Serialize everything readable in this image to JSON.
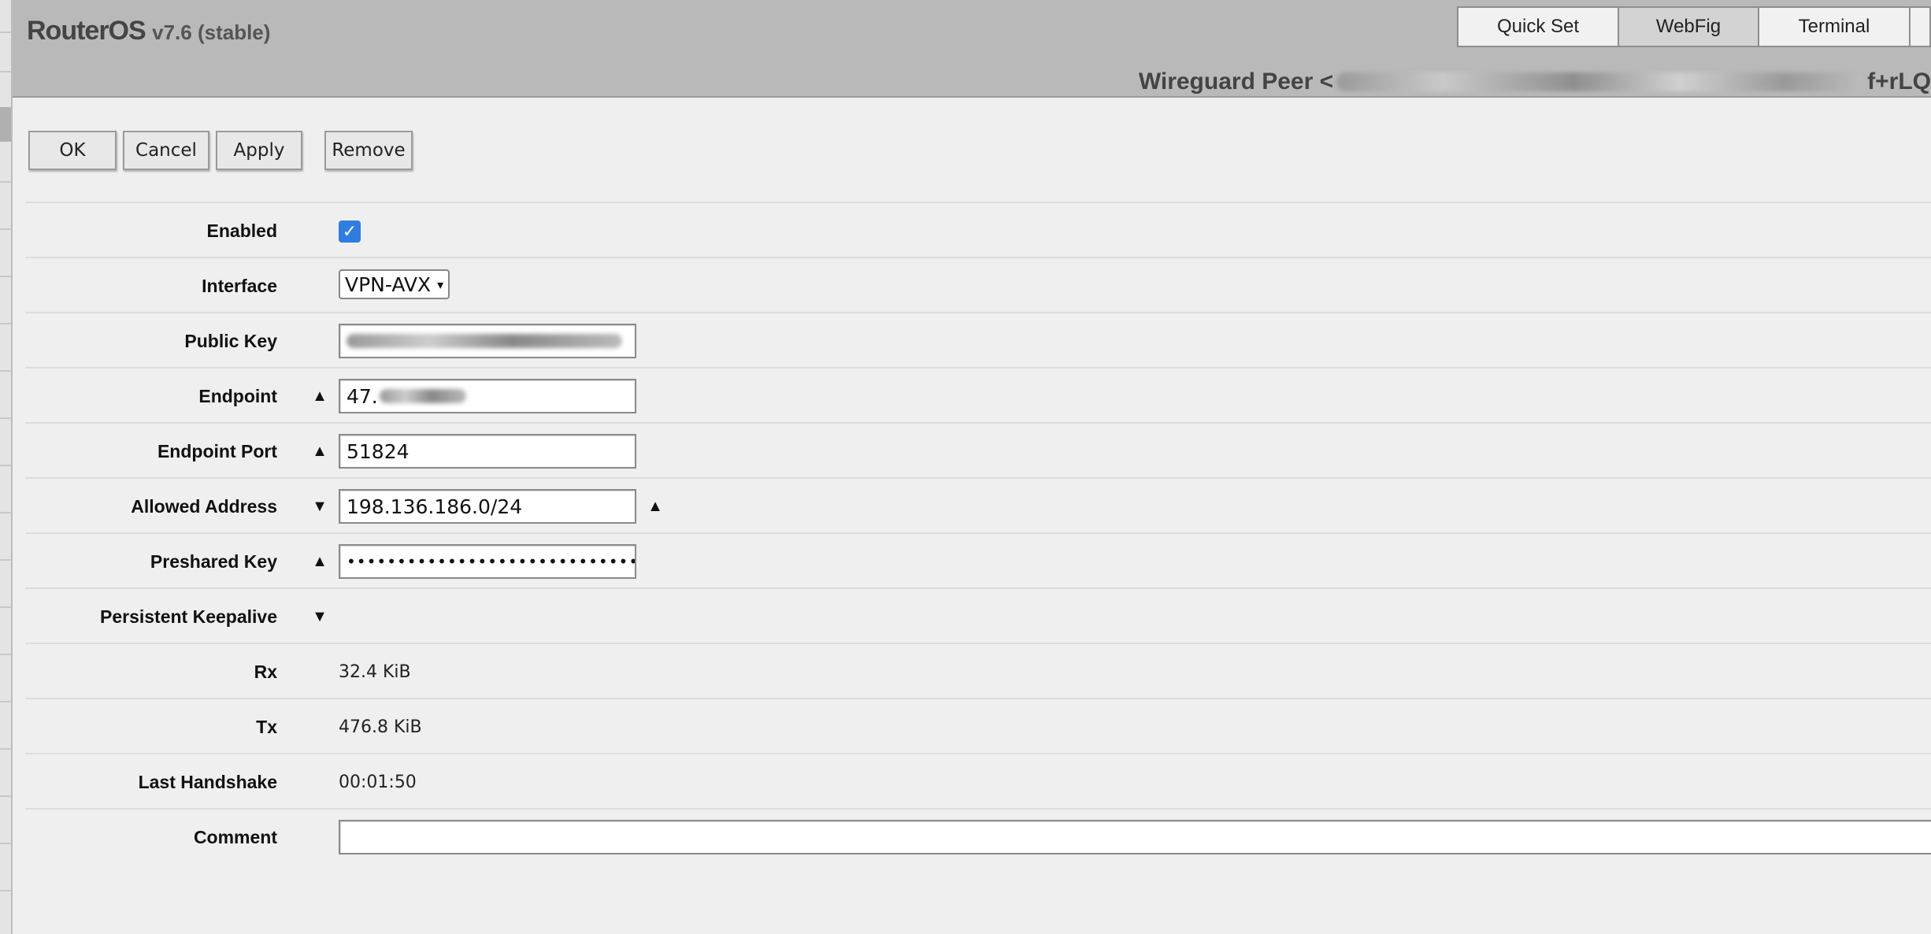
{
  "header": {
    "brand": "RouterOS",
    "version": "v7.6 (stable)",
    "tabs": [
      "Quick Set",
      "WebFig",
      "Terminal"
    ],
    "active_tab": "WebFig",
    "page_title_prefix": "Wireguard Peer <",
    "page_title_suffix": "f+rLQ"
  },
  "toolbar": {
    "ok_label": "OK",
    "cancel_label": "Cancel",
    "apply_label": "Apply",
    "remove_label": "Remove"
  },
  "form": {
    "enabled": {
      "label": "Enabled",
      "checked": true
    },
    "interface": {
      "label": "Interface",
      "value": "VPN-AVX"
    },
    "public_key": {
      "label": "Public Key"
    },
    "endpoint": {
      "label": "Endpoint",
      "value": "47."
    },
    "endpoint_port": {
      "label": "Endpoint Port",
      "value": "51824"
    },
    "allowed_address": {
      "label": "Allowed Address",
      "value": "198.136.186.0/24"
    },
    "preshared_key": {
      "label": "Preshared Key",
      "value": "••••••••••••••••••••••••••••••••"
    },
    "persistent_keepalive": {
      "label": "Persistent Keepalive"
    },
    "rx": {
      "label": "Rx",
      "value": "32.4 KiB"
    },
    "tx": {
      "label": "Tx",
      "value": "476.8 KiB"
    },
    "last_handshake": {
      "label": "Last Handshake",
      "value": "00:01:50"
    },
    "comment": {
      "label": "Comment",
      "value": ""
    }
  },
  "icons": {
    "expand_up": "▲",
    "expand_down": "▼",
    "checkmark": "✓",
    "select_chevron": "⌄"
  },
  "colors": {
    "header_bg": "#b9b9b9",
    "checkbox_blue": "#2f7de1",
    "page_bg": "#efefef"
  }
}
